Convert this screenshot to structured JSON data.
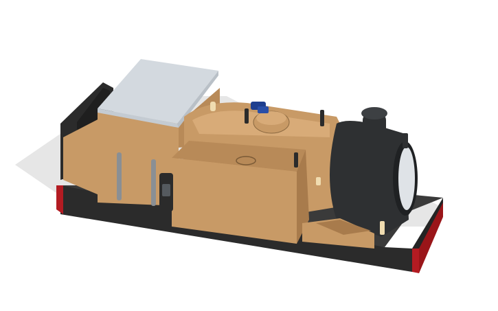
{
  "scene": {
    "subject": "3d-locomotive-model",
    "colors": {
      "background": "#ffffff",
      "ground_shadow": "#e6e6e6",
      "body_tan": "#c89a66",
      "body_tan_light": "#d8ab78",
      "body_tan_dark": "#a87b4c",
      "frame_black": "#2b2b2b",
      "frame_top": "#3a3a3a",
      "buffer_red": "#b31b22",
      "cab_roof": "#d3d9df",
      "smokebox_black": "#2e3032",
      "headlamp_glass": "#dfe3e7",
      "pipe_grey": "#8a8f94",
      "valve_blue": "#1f3f8f",
      "whistle_cream": "#f0dcb0"
    }
  }
}
